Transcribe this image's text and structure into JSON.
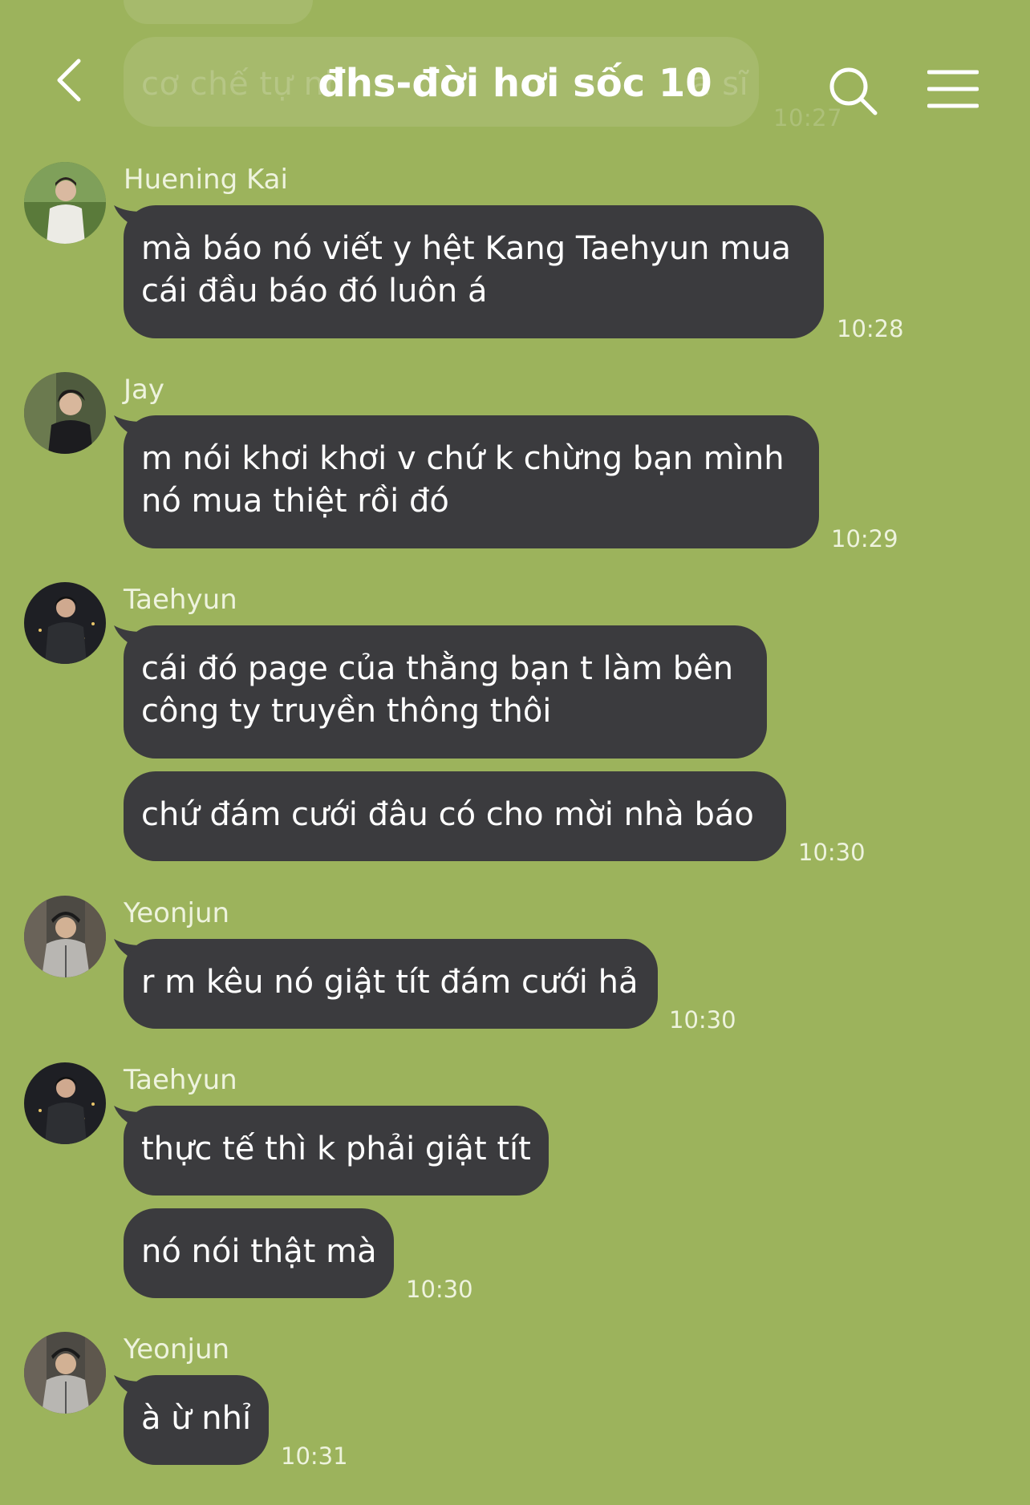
{
  "header": {
    "title": "đhs-đời hơi sốc 10"
  },
  "ghost": {
    "text": "cơ chế tự nh",
    "text_right": "a sĩ",
    "time": "10:27"
  },
  "messages": [
    {
      "sender": "Huening Kai",
      "lines": [
        "mà báo nó viết y hệt Kang Taehyun mua",
        "cái đầu báo đó luôn á"
      ],
      "time": "10:28"
    },
    {
      "sender": "Jay",
      "lines": [
        "m nói khơi khơi v chứ k chừng bạn mình",
        "nó mua thiệt rồi đó"
      ],
      "time": "10:29"
    },
    {
      "sender": "Taehyun",
      "lines": [
        "cái đó page của thằng bạn t làm bên",
        "công ty truyền thông thôi"
      ]
    },
    {
      "lines": [
        "chứ đám cưới đâu có cho mời nhà báo"
      ],
      "time": "10:30"
    },
    {
      "sender": "Yeonjun",
      "lines": [
        "r m kêu nó giật tít đám cưới hả"
      ],
      "time": "10:30"
    },
    {
      "sender": "Taehyun",
      "lines": [
        "thực tế thì k phải giật tít"
      ]
    },
    {
      "lines": [
        "nó nói thật mà"
      ],
      "time": "10:30"
    },
    {
      "sender": "Yeonjun",
      "lines": [
        "à ừ nhỉ"
      ],
      "time": "10:31"
    }
  ],
  "colors": {
    "background": "#9cb35c",
    "bubble": "#3b3b3e",
    "text": "#ffffff"
  },
  "icons": {
    "back": "chevron-left-icon",
    "search": "search-icon",
    "menu": "hamburger-menu-icon"
  }
}
